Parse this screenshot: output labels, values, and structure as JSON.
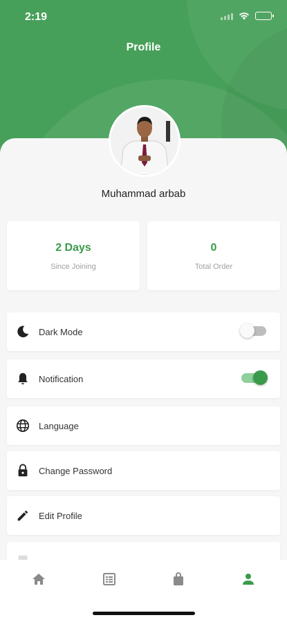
{
  "status_bar": {
    "time": "2:19",
    "icons": [
      "signal-icon",
      "wifi-icon",
      "battery-icon"
    ]
  },
  "header": {
    "title": "Profile",
    "color": "#47a05a"
  },
  "user": {
    "name": "Muhammad arbab"
  },
  "stats": [
    {
      "value": "2 Days",
      "label": "Since Joining"
    },
    {
      "value": "0",
      "label": "Total Order"
    }
  ],
  "menu": [
    {
      "icon": "moon-icon",
      "label": "Dark Mode",
      "toggle": "off"
    },
    {
      "icon": "bell-icon",
      "label": "Notification",
      "toggle": "on"
    },
    {
      "icon": "globe-icon",
      "label": "Language"
    },
    {
      "icon": "lock-icon",
      "label": "Change Password"
    },
    {
      "icon": "pencil-icon",
      "label": "Edit Profile"
    }
  ],
  "bottom_nav": [
    {
      "icon": "home-icon",
      "active": false
    },
    {
      "icon": "orders-list-icon",
      "active": false
    },
    {
      "icon": "shopping-bag-icon",
      "active": false
    },
    {
      "icon": "person-icon",
      "active": true
    }
  ],
  "colors": {
    "accent": "#3a9a4b",
    "inactive_icon": "#8a8a8a"
  }
}
